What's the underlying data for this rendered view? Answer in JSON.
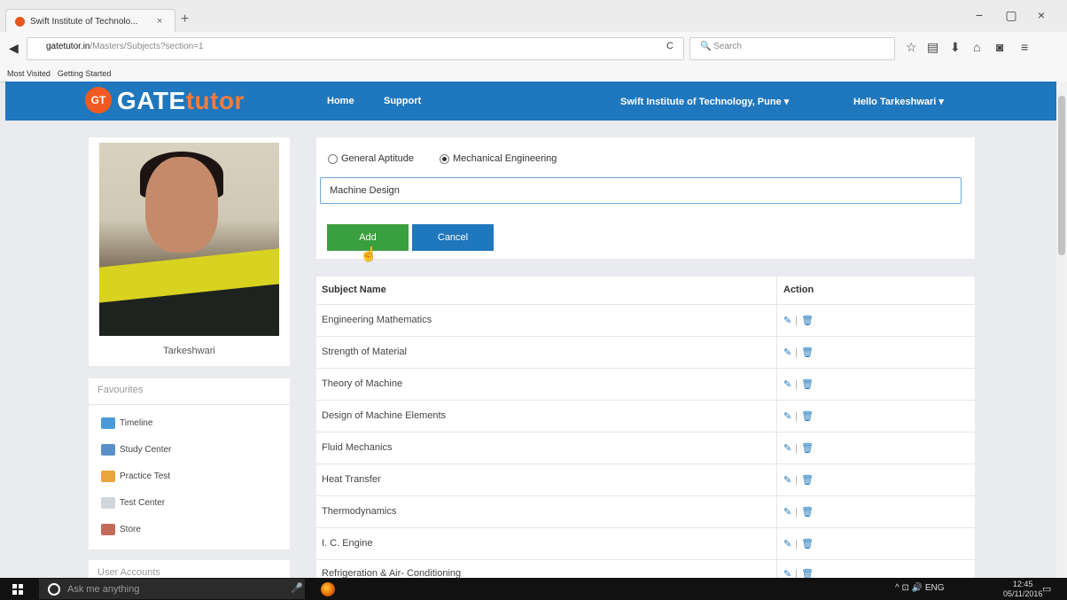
{
  "browser": {
    "tab_title": "Swift Institute of Technolo...",
    "tab_close": "×",
    "new_tab": "+",
    "window_controls": [
      "−",
      "▢",
      "×"
    ],
    "url_domain": "gatetutor.in",
    "url_path": "/Masters/Subjects?section=1",
    "search_placeholder": "Search",
    "reload": "C",
    "bookmarks": [
      "Most Visited",
      "Getting Started"
    ],
    "toolbar_icons": [
      "star-icon",
      "reading-list-icon",
      "download-icon",
      "home-icon",
      "pocket-icon",
      "menu-icon"
    ]
  },
  "header": {
    "logo_badge": "GT",
    "logo_part1": "GATE",
    "logo_part2": "tutor",
    "nav": [
      "Home",
      "Support"
    ],
    "institute": "Swift Institute of Technology, Pune ▾",
    "user_menu": "Hello Tarkeshwari ▾",
    "bar_color": "#1f77bd"
  },
  "sidebar": {
    "username": "Tarkeshwari",
    "favourites_title": "Favourites",
    "favourites": [
      {
        "label": "Timeline",
        "icon": "timeline-icon"
      },
      {
        "label": "Study Center",
        "icon": "study-center-icon"
      },
      {
        "label": "Practice Test",
        "icon": "practice-test-icon"
      },
      {
        "label": "Test Center",
        "icon": "test-center-icon"
      },
      {
        "label": "Store",
        "icon": "store-icon"
      }
    ],
    "user_accounts_title": "User Accounts"
  },
  "form": {
    "radio_options": [
      {
        "label": "General Aptitude",
        "selected": false
      },
      {
        "label": "Mechanical Engineering",
        "selected": true
      }
    ],
    "subject_value": "Machine Design",
    "add_label": "Add",
    "cancel_label": "Cancel",
    "add_color": "#3a9f3e",
    "cancel_color": "#1f77bd"
  },
  "table": {
    "headers": [
      "Subject Name",
      "Action"
    ],
    "rows": [
      "Engineering Mathematics",
      "Strength of Material",
      "Theory of Machine",
      "Design of Machine Elements",
      "Fluid Mechanics",
      "Heat Transfer",
      "Thermodynamics",
      "I. C. Engine",
      "Refrigeration & Air- Conditioning"
    ],
    "action_edit": "✎",
    "action_sep": "|",
    "action_delete": "🗑"
  },
  "taskbar": {
    "search_placeholder": "Ask me anything",
    "tray_text": "^ ⊡ 🔊 ENG",
    "time": "12:45",
    "date": "05/11/2016"
  }
}
